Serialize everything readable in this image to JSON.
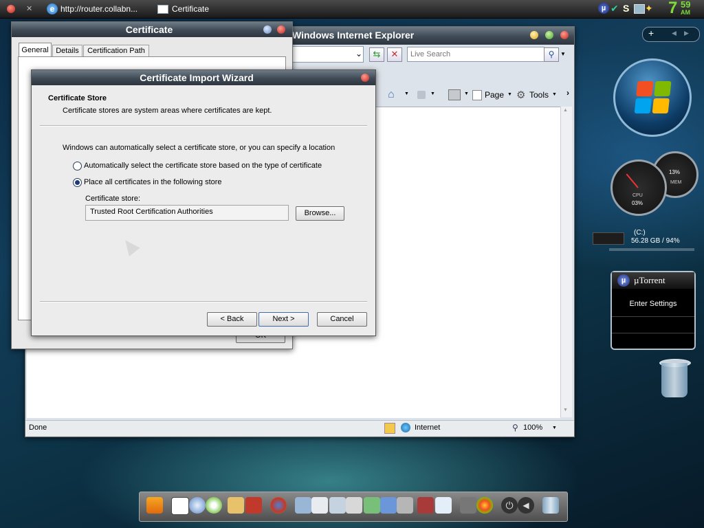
{
  "topbar": {
    "address_text": "http://router.collabn...",
    "certificate_task": "Certificate",
    "clock": {
      "hour": "7",
      "minute": "59",
      "ampm": "AM"
    }
  },
  "ie": {
    "title": "Windows Internet Explorer",
    "search_placeholder": "Live Search",
    "page_menu": "Page",
    "tools_menu": "Tools",
    "status_text": "Done",
    "zone": "Internet",
    "zoom": "100%"
  },
  "cert_dialog": {
    "title": "Certificate",
    "tabs": [
      "General",
      "Details",
      "Certification Path"
    ],
    "ok_label": "OK"
  },
  "wizard": {
    "title": "Certificate Import Wizard",
    "heading": "Certificate Store",
    "subheading": "Certificate stores are system areas where certificates are kept.",
    "intro": "Windows can automatically select a certificate store, or you can specify a location",
    "option_auto": "Automatically select the certificate store based on the type of certificate",
    "option_manual": "Place all certificates in the following store",
    "selected_option": "manual",
    "store_label": "Certificate store:",
    "store_value": "Trusted Root Certification Authorities",
    "browse_label": "Browse...",
    "back_label": "< Back",
    "next_label": "Next >",
    "cancel_label": "Cancel"
  },
  "gadgets": {
    "cpu_label": "CPU",
    "cpu_value": "03%",
    "mem_label": "MEM",
    "mem_value": "13%",
    "drive_label": "(C:)",
    "drive_info": "56.28 GB / 94%",
    "utorrent_title": "µTorrent",
    "utorrent_settings": "Enter Settings"
  },
  "colors": {
    "accent_blue": "#1c3a78",
    "close_red": "#d9382f",
    "dock_bg": "#6d6d6d"
  }
}
